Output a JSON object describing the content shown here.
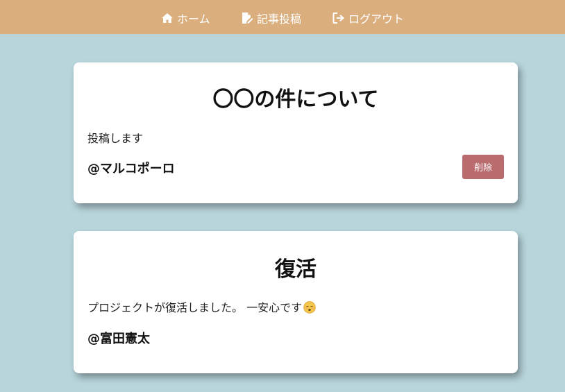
{
  "nav": {
    "home_label": "ホーム",
    "home_icon": "home-icon",
    "post_label": "記事投稿",
    "post_icon": "edit-file-icon",
    "logout_label": "ログアウト",
    "logout_icon": "logout-icon",
    "background": "#dbae7e"
  },
  "page": {
    "background": "#b8d5dc"
  },
  "posts": [
    {
      "title": "〇〇の件について",
      "body": "投稿します",
      "author": "@マルコポーロ",
      "delete_label": "削除"
    },
    {
      "title": "復活",
      "body": "プロジェクトが復活しました。 一安心です",
      "emoji": "relieved-face-icon",
      "author": "@富田憲太"
    }
  ],
  "colors": {
    "delete_button": "#b96b6e"
  }
}
